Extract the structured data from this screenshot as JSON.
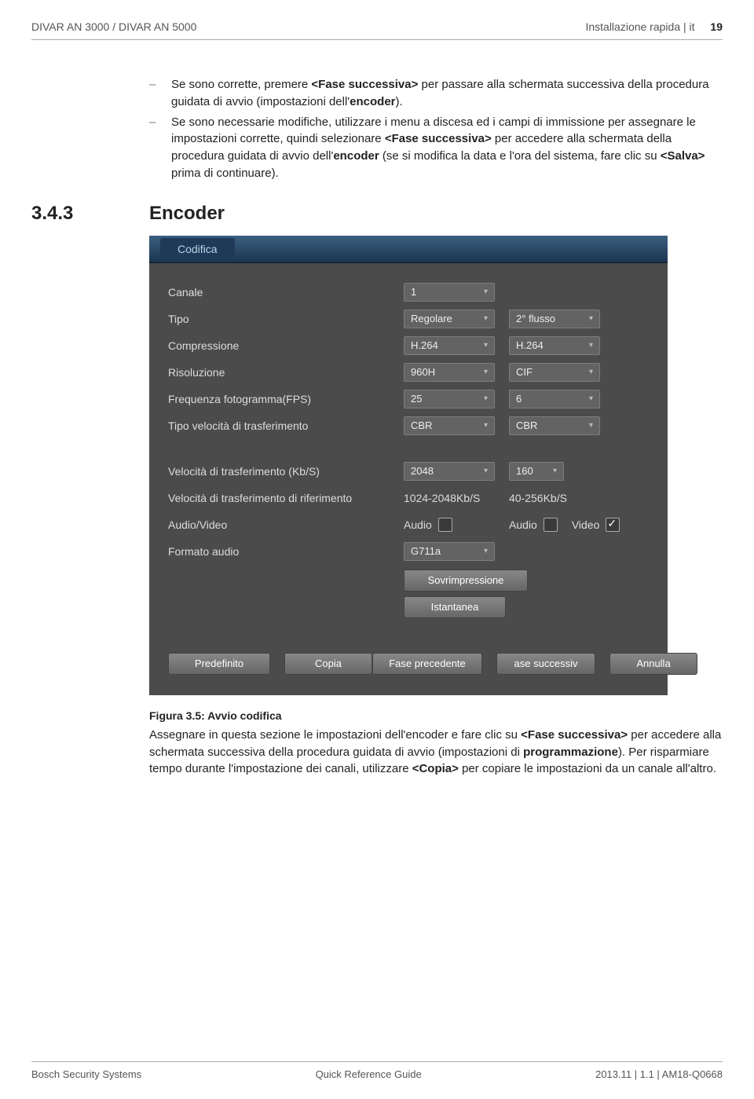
{
  "header": {
    "product": "DIVAR AN 3000 / DIVAR AN 5000",
    "section_name": "Installazione rapida | it",
    "page_number": "19"
  },
  "bullets": [
    {
      "pre": "Se sono corrette, premere ",
      "bold1": "<Fase successiva>",
      "mid": " per passare alla schermata successiva della procedura guidata di avvio (impostazioni dell'",
      "bold2": "encoder",
      "post": ")."
    },
    {
      "pre": "Se sono necessarie modifiche, utilizzare i menu a discesa ed i campi di immissione per assegnare le impostazioni corrette, quindi selezionare ",
      "bold1": "<Fase successiva>",
      "mid": " per accedere alla schermata della procedura guidata di avvio dell'",
      "bold2": "encoder",
      "post": " (se si modifica la data e l'ora del sistema, fare clic su ",
      "bold3": "<Salva>",
      "post2": " prima di continuare)."
    }
  ],
  "section": {
    "number": "3.4.3",
    "title": "Encoder"
  },
  "ui": {
    "title_tab": "Codifica",
    "rows": {
      "canale": {
        "label": "Canale",
        "value": "1"
      },
      "tipo": {
        "label": "Tipo",
        "value": "Regolare",
        "value_b": "2° flusso"
      },
      "compressione": {
        "label": "Compressione",
        "value": "H.264",
        "value_b": "H.264"
      },
      "risoluzione": {
        "label": "Risoluzione",
        "value": "960H",
        "value_b": "CIF"
      },
      "fps": {
        "label": "Frequenza fotogramma(FPS)",
        "value": "25",
        "value_b": "6"
      },
      "bitrate_type": {
        "label": "Tipo velocità di trasferimento",
        "value": "CBR",
        "value_b": "CBR"
      },
      "bitrate": {
        "label": "Velocità di trasferimento (Kb/S)",
        "value": "2048",
        "value_b": "160"
      },
      "ref_bitrate": {
        "label": "Velocità di trasferimento di riferimento",
        "value": "1024-2048Kb/S",
        "value_b": "40-256Kb/S"
      },
      "av": {
        "label": "Audio/Video",
        "audio_a": "Audio",
        "audio_b": "Audio",
        "video_b": "Video",
        "check_a": false,
        "check_b_audio": false,
        "check_b_video": true
      },
      "audio_fmt": {
        "label": "Formato audio",
        "value": "G711a"
      }
    },
    "extra_buttons": {
      "overlay": "Sovrimpressione",
      "snapshot": "Istantanea"
    },
    "footer_buttons": {
      "default": "Predefinito",
      "copy": "Copia",
      "prev": "Fase precedente",
      "next": "ase successiv",
      "cancel": "Annulla"
    }
  },
  "caption": {
    "title": "Figura 3.5: Avvio codifica",
    "body_pre": "Assegnare in questa sezione le impostazioni dell'encoder e fare clic su ",
    "body_b1": "<Fase successiva>",
    "body_mid": " per accedere alla schermata successiva della procedura guidata di avvio (impostazioni di ",
    "body_b2": "programmazione",
    "body_mid2": "). Per risparmiare tempo durante l'impostazione dei canali, utilizzare ",
    "body_b3": "<Copia>",
    "body_post": " per copiare le impostazioni da un canale all'altro."
  },
  "footer": {
    "left": "Bosch Security Systems",
    "center": "Quick Reference Guide",
    "right": "2013.11 | 1.1 | AM18-Q0668"
  }
}
